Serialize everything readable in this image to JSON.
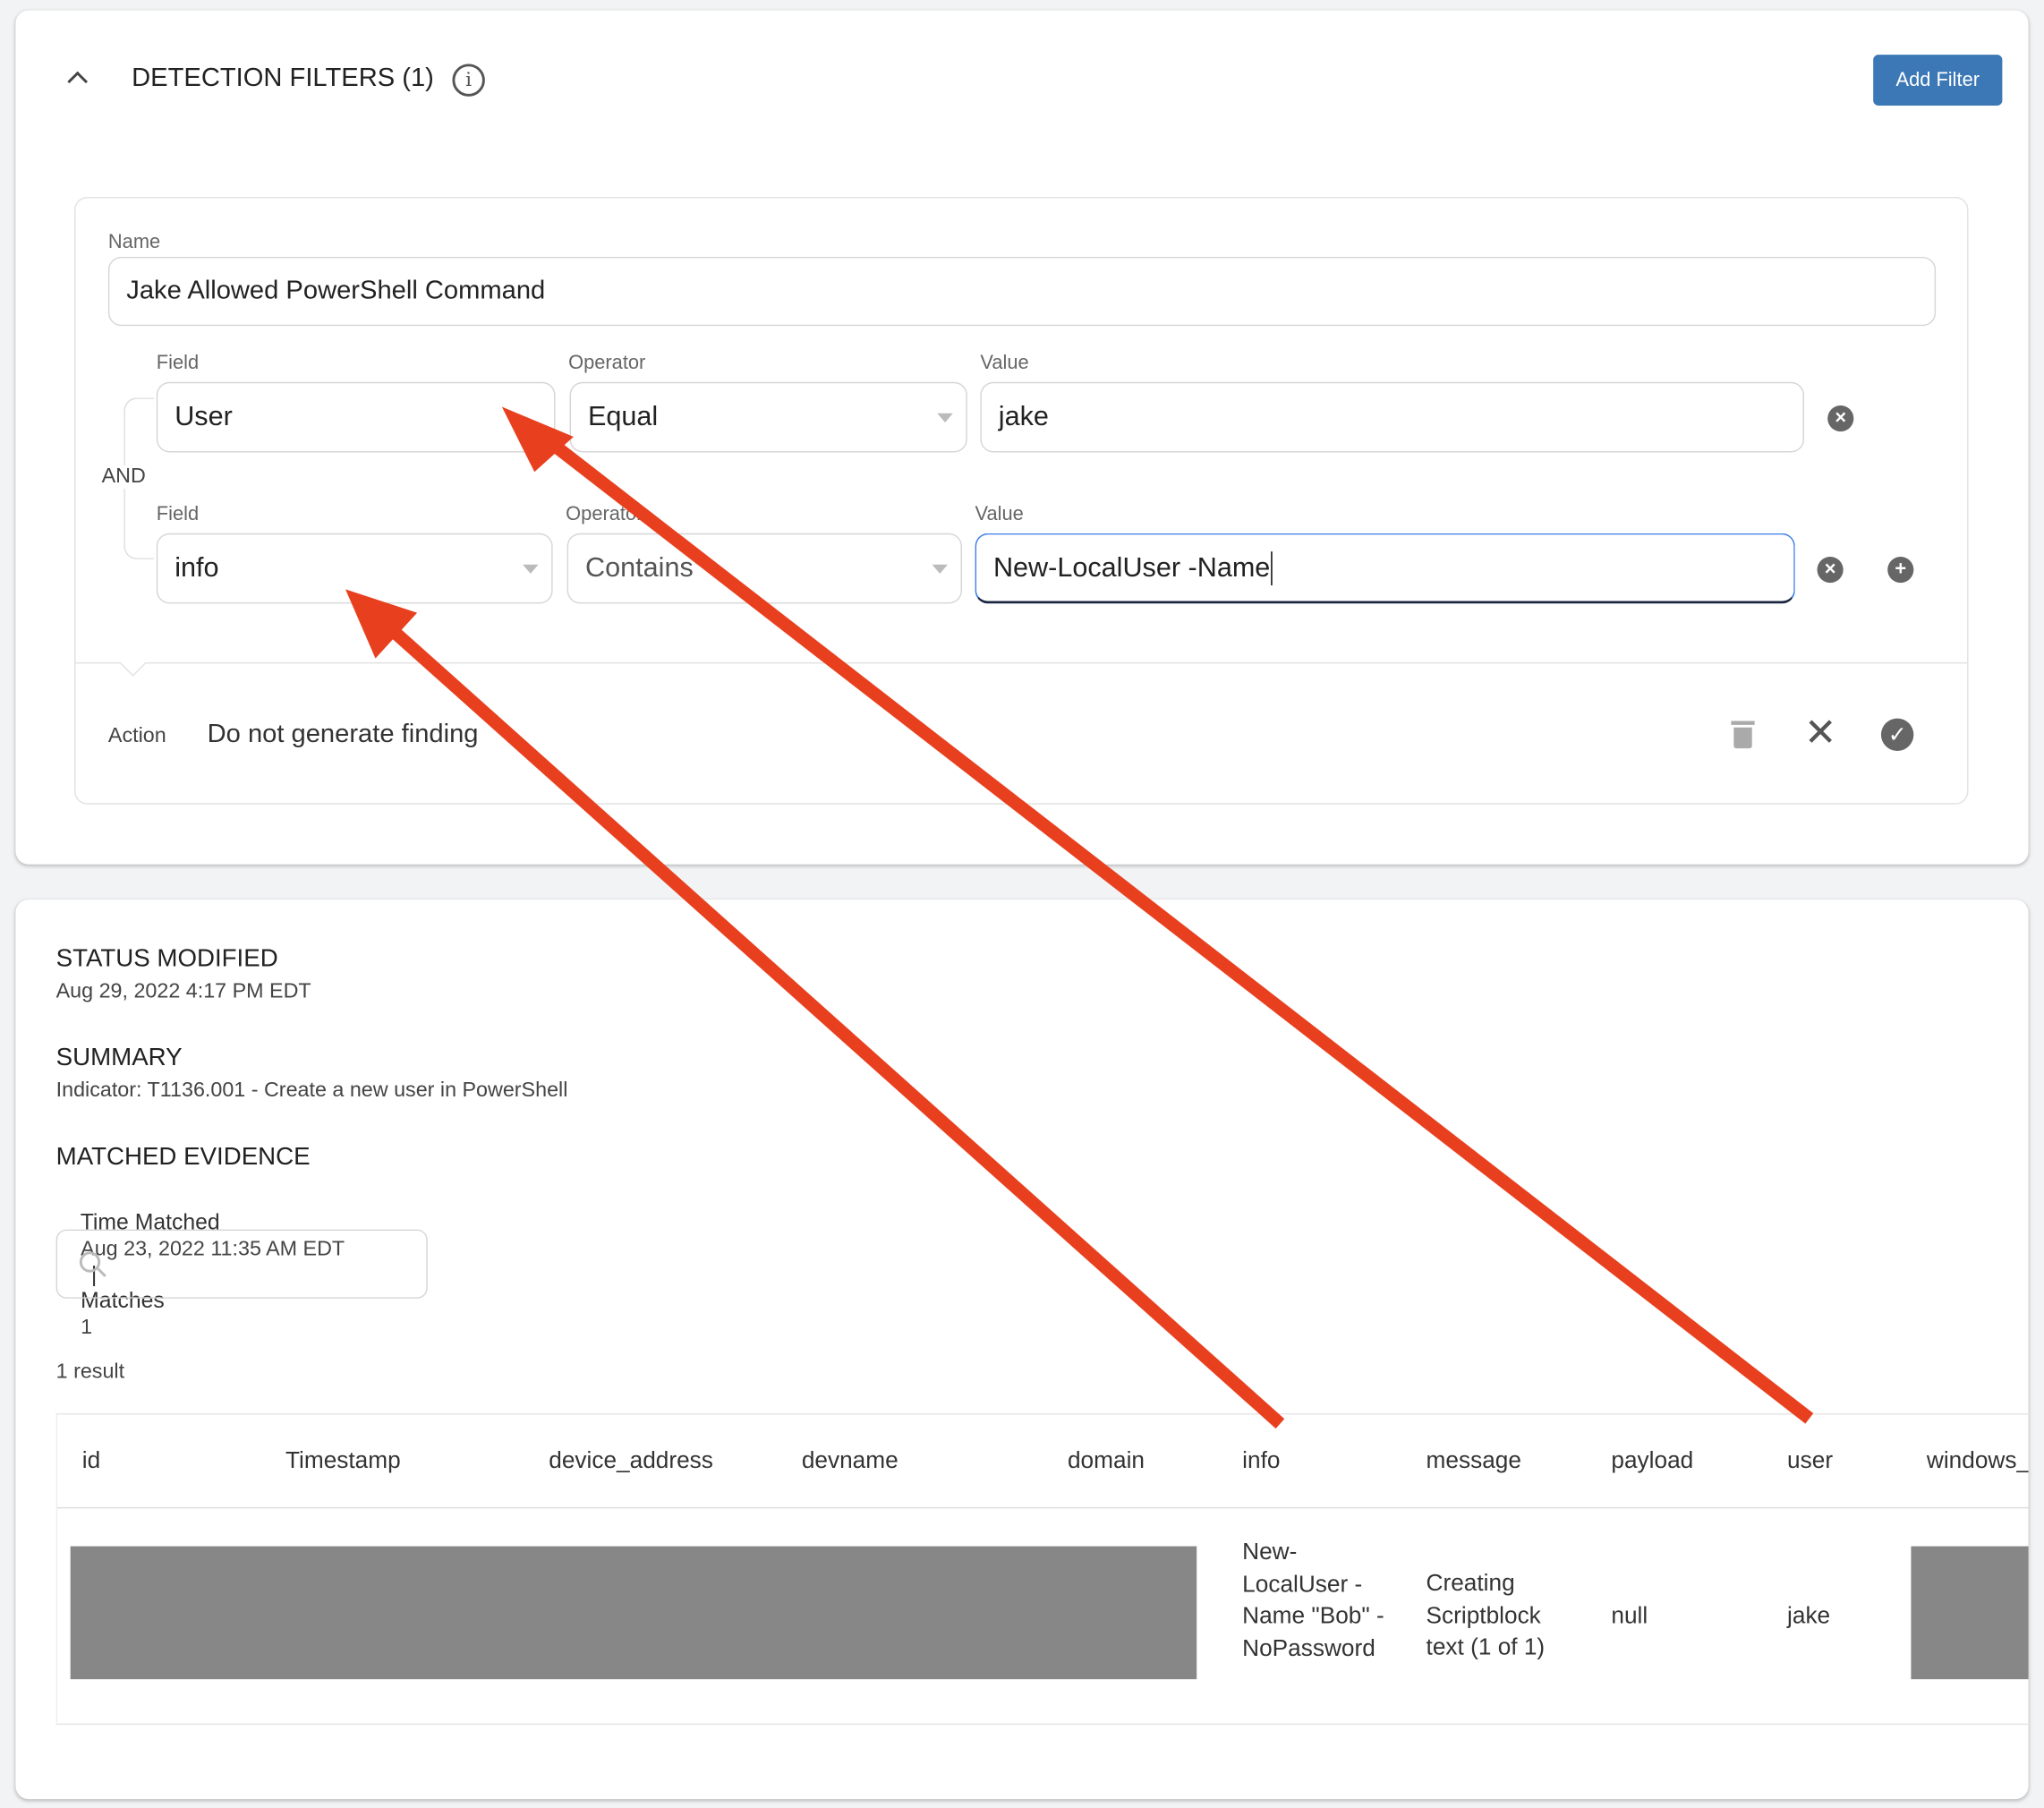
{
  "filters": {
    "title": "DETECTION FILTERS (1)",
    "add_filter_label": "Add Filter",
    "name_label": "Name",
    "name_value": "Jake Allowed PowerShell Command",
    "conjunction": "AND",
    "conditions": [
      {
        "field_label": "Field",
        "field": "User",
        "operator_label": "Operator",
        "operator": "Equal",
        "value_label": "Value",
        "value": "jake"
      },
      {
        "field_label": "Field",
        "field": "info",
        "operator_label": "Operator",
        "operator": "Contains",
        "value_label": "Value",
        "value": "New-LocalUser -Name"
      }
    ],
    "action_label": "Action",
    "action_value": "Do not generate finding"
  },
  "details": {
    "status_title": "STATUS MODIFIED",
    "status_value": "Aug 29, 2022 4:17 PM EDT",
    "summary_title": "SUMMARY",
    "summary_value": "Indicator: T1136.001 - Create a new user in PowerShell",
    "evidence_title": "MATCHED EVIDENCE",
    "time_matched_label": "Time Matched",
    "time_matched_value": "Aug 23, 2022 11:35 AM EDT",
    "separator": "|",
    "matches_label": "Matches",
    "matches_value": "1",
    "result_count": "1 result"
  },
  "table": {
    "columns": [
      "id",
      "Timestamp",
      "device_address",
      "devname",
      "domain",
      "info",
      "message",
      "payload",
      "user",
      "windows_"
    ],
    "row": {
      "info": "New-LocalUser -Name \"Bob\" -NoPassword",
      "message": "Creating Scriptblock text (1 of 1)",
      "payload": "null",
      "user": "jake"
    }
  },
  "colors": {
    "accent": "#3b78b5",
    "arrow": "#e8401f",
    "redaction": "#878787"
  }
}
